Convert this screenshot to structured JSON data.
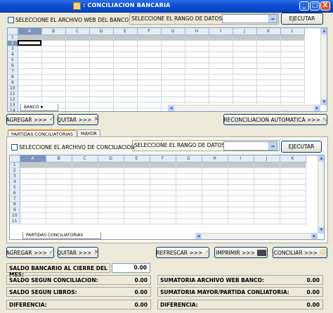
{
  "window": {
    "title": ": CONCILIACION BANCARIA",
    "controls": {
      "minimize": "_",
      "maximize": "□",
      "close": "X"
    }
  },
  "bank": {
    "checkbox_label": "SELECCIONE EL ARCHIVO WEB DEL BANCO",
    "range_label": "SELECCIONE EL RANGO DE DATOS:",
    "range_value": "",
    "execute": "EJECUTAR",
    "sheet_tab": "BANCO",
    "columns": [
      "A",
      "B",
      "C",
      "D",
      "E",
      "F",
      "G",
      "H",
      "I",
      "J",
      "K",
      "L"
    ],
    "rows": [
      "1",
      "2",
      "3",
      "4",
      "5",
      "6",
      "7",
      "8",
      "9",
      "10",
      "11",
      "12",
      "13",
      "14"
    ]
  },
  "actions_top": {
    "add": "AGREGAR >>>",
    "remove": "QUITAR >>>",
    "auto": "RECONCILIACION AUTOMATICA >>>"
  },
  "tabs": [
    "PARTIDAS CONCILIATORIAS",
    "MAYOR"
  ],
  "recon": {
    "checkbox_label": "SELECCIONE EL ARCHIVO DE CONCILIACION",
    "range_label": "SELECCIONE EL RANGO DE DATOS:",
    "range_value": "",
    "execute": "EJECUTAR",
    "sheet_tab": "PARTIDAS CONCILIATORIAS",
    "columns": [
      "A",
      "B",
      "C",
      "D",
      "E",
      "F",
      "G",
      "H",
      "I",
      "J",
      "K"
    ],
    "rows": [
      "1",
      "2",
      "3",
      "4",
      "5",
      "6",
      "7",
      "8",
      "9",
      "10",
      "11"
    ]
  },
  "actions_bottom": {
    "add": "AGREGAR >>>",
    "remove": "QUITAR >>>",
    "refresh": "REFRESCAR >>>",
    "print": "IMPRIMIR >>>",
    "reconcile": "CONCILIAR >>>"
  },
  "summary": {
    "bank_balance_label": "SALDO BANCARIO AL CIERRE DEL MES:",
    "bank_balance_value": "0.00",
    "left": [
      {
        "label": "SALDO SEGUN CONCILIACION:",
        "value": "0.00"
      },
      {
        "label": "SALDO SEGUN LIBROS:",
        "value": "0.00"
      },
      {
        "label": "DIFERENCIA:",
        "value": "0.00"
      }
    ],
    "right": [
      {
        "label": "SUMATORIA ARCHIVO WEB BANCO:",
        "value": "0.00"
      },
      {
        "label": "SUMATORIA MAYOR/PARTIDA CONLIATORIA:",
        "value": "0.00"
      },
      {
        "label": "DIFERENCIA:",
        "value": "0.00"
      }
    ]
  },
  "colors": {
    "title_bar": "#0a4fd4",
    "check_green": "#2e9b2e",
    "x_red": "#d42b2b",
    "selected_header": "#7b95c0"
  }
}
